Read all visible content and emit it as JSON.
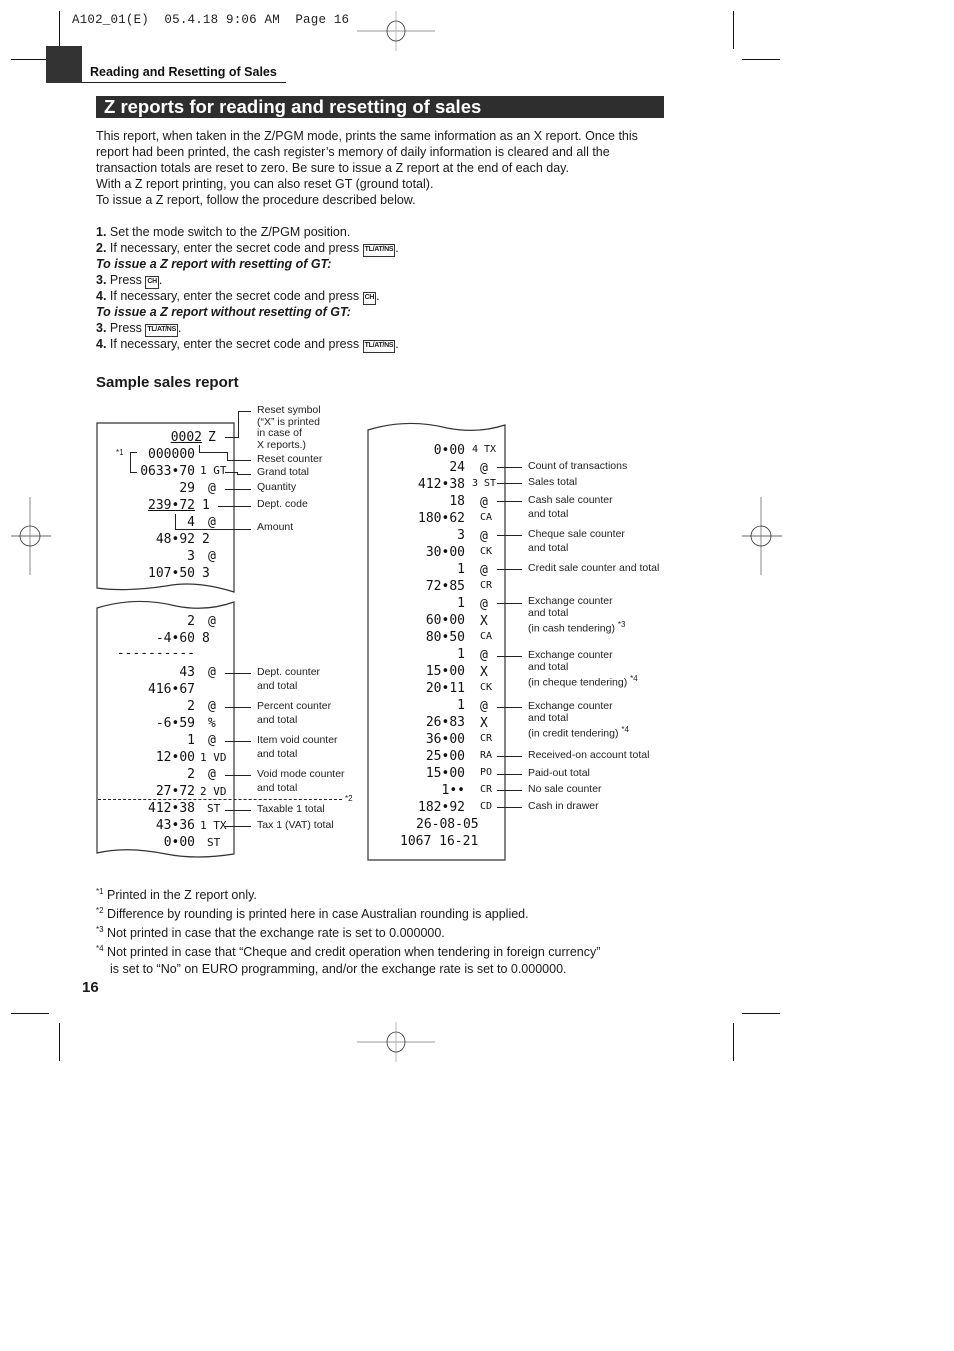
{
  "print_header": {
    "text": "A102_01(E)  05.4.18 9:06 AM  Page 16"
  },
  "section_label": "Reading and Resetting of Sales",
  "title": "Z reports for reading and resetting of sales",
  "intro": [
    "This report, when taken in the Z/PGM mode, prints the same information as an X report.  Once this",
    "report had been printed, the cash register’s memory of daily information is cleared and all the",
    "transaction totals are reset to zero.  Be sure to issue a Z report at the end of each day.",
    "With a Z report printing, you can also reset GT (ground total).",
    "To issue a Z report, follow the procedure described below."
  ],
  "steps": [
    {
      "num": "1.",
      "text": "Set the mode switch to the Z/PGM position.",
      "key": ""
    },
    {
      "num": "2.",
      "text": "If necessary, enter the secret code and press",
      "key": "TL/AT/NS"
    },
    {
      "subhead": "To issue a Z report with resetting of GT:"
    },
    {
      "num": "3.",
      "text": "Press",
      "key": "CH"
    },
    {
      "num": "4.",
      "text": "If necessary, enter the secret code and press",
      "key": "CH"
    },
    {
      "subhead": "To issue a Z report without resetting of GT:"
    },
    {
      "num": "3.",
      "text": "Press",
      "key": "TL/AT/NS"
    },
    {
      "num": "4.",
      "text": "If necessary, enter the secret code and press",
      "key": "TL/AT/NS"
    }
  ],
  "sample_title": "Sample sales report",
  "receipt_left_top": [
    {
      "value": "0002",
      "sym": "Z"
    },
    {
      "value": "000000",
      "sym": ""
    },
    {
      "value": "0633•70",
      "sym": "1 GT"
    },
    {
      "value": "29",
      "sym": "@"
    },
    {
      "value": "239•72",
      "sym": "1"
    },
    {
      "value": "4",
      "sym": "@"
    },
    {
      "value": "48•92",
      "sym": "2"
    },
    {
      "value": "3",
      "sym": "@"
    },
    {
      "value": "107•50",
      "sym": "3"
    }
  ],
  "receipt_left_bottom": [
    {
      "value": "2",
      "sym": "@"
    },
    {
      "value": "-4•60",
      "sym": "8"
    },
    {
      "value": "----------",
      "sym": ""
    },
    {
      "value": "43",
      "sym": "@"
    },
    {
      "value": "416•67",
      "sym": ""
    },
    {
      "value": "2",
      "sym": "@"
    },
    {
      "value": "-6•59",
      "sym": "%"
    },
    {
      "value": "1",
      "sym": "@"
    },
    {
      "value": "12•00",
      "sym": "1 VD"
    },
    {
      "value": "2",
      "sym": "@"
    },
    {
      "value": "27•72",
      "sym": "2 VD"
    },
    {
      "value": "412•38",
      "sym": "ST"
    },
    {
      "value": "43•36",
      "sym": "1 TX"
    },
    {
      "value": "0•00",
      "sym": "ST"
    }
  ],
  "receipt_right": [
    {
      "value": "0•00",
      "sym": "4 TX"
    },
    {
      "value": "24",
      "sym": "@"
    },
    {
      "value": "412•38",
      "sym": "3 ST"
    },
    {
      "value": "18",
      "sym": "@"
    },
    {
      "value": "180•62",
      "sym": "CA"
    },
    {
      "value": "3",
      "sym": "@"
    },
    {
      "value": "30•00",
      "sym": "CK"
    },
    {
      "value": "1",
      "sym": "@"
    },
    {
      "value": "72•85",
      "sym": "CR"
    },
    {
      "value": "1",
      "sym": "@"
    },
    {
      "value": "60•00",
      "sym": "X"
    },
    {
      "value": "80•50",
      "sym": "CA"
    },
    {
      "value": "1",
      "sym": "@"
    },
    {
      "value": "15•00",
      "sym": "X"
    },
    {
      "value": "20•11",
      "sym": "CK"
    },
    {
      "value": "1",
      "sym": "@"
    },
    {
      "value": "26•83",
      "sym": "X"
    },
    {
      "value": "36•00",
      "sym": "CR"
    },
    {
      "value": "25•00",
      "sym": "RA"
    },
    {
      "value": "15•00",
      "sym": "PO"
    },
    {
      "value": "1••",
      "sym": "CR"
    },
    {
      "value": "182•92",
      "sym": "CD"
    },
    {
      "value": "26-08-05",
      "sym": ""
    },
    {
      "value": "1067 16-21",
      "sym": ""
    }
  ],
  "labels_left": {
    "reset_symbol": [
      "Reset symbol",
      "(“X” is printed",
      "in case of",
      "X reports.)"
    ],
    "reset_counter": "Reset counter",
    "grand_total": "Grand total",
    "quantity": "Quantity",
    "dept_code": "Dept. code",
    "amount": "Amount",
    "dept_counter": [
      "Dept. counter",
      "and total"
    ],
    "percent_counter": [
      "Percent counter",
      "and total"
    ],
    "item_void": [
      "Item void counter",
      "and total"
    ],
    "void_mode": [
      "Void mode counter",
      "and total"
    ],
    "taxable1": "Taxable 1 total",
    "tax1": "Tax 1 (VAT) total",
    "note1_marker": "*1",
    "note2_marker": "*2"
  },
  "labels_right": {
    "count_trans": "Count of transactions",
    "sales_total": "Sales total",
    "cash_sale": [
      "Cash sale counter",
      "and total"
    ],
    "cheque_sale": [
      "Cheque sale counter",
      "and total"
    ],
    "credit_sale": "Credit sale counter and total",
    "exch_cash": [
      "Exchange counter",
      "and total",
      "(in cash tendering)"
    ],
    "exch_cash_note": "*3",
    "exch_cheque": [
      "Exchange counter",
      "and total",
      "(in cheque tendering)"
    ],
    "exch_cheque_note": "*4",
    "exch_credit": [
      "Exchange counter",
      "and total",
      "(in credit tendering)"
    ],
    "exch_credit_note": "*4",
    "received_on_account": "Received-on account total",
    "paid_out": "Paid-out total",
    "no_sale": "No sale counter",
    "cash_in_drawer": "Cash in drawer"
  },
  "footnotes": [
    {
      "mark": "*1",
      "text": "Printed in the Z report only."
    },
    {
      "mark": "*2",
      "text": "Difference by rounding is printed here in case Australian rounding is applied."
    },
    {
      "mark": "*3",
      "text": "Not printed in case that the exchange rate is set to 0.000000."
    },
    {
      "mark": "*4",
      "text": "Not printed in case that “Cheque and credit operation when tendering in foreign currency”"
    },
    {
      "mark": "",
      "text": "is set to “No” on EURO programming, and/or the exchange rate is set to 0.000000."
    }
  ],
  "page_number": "16"
}
